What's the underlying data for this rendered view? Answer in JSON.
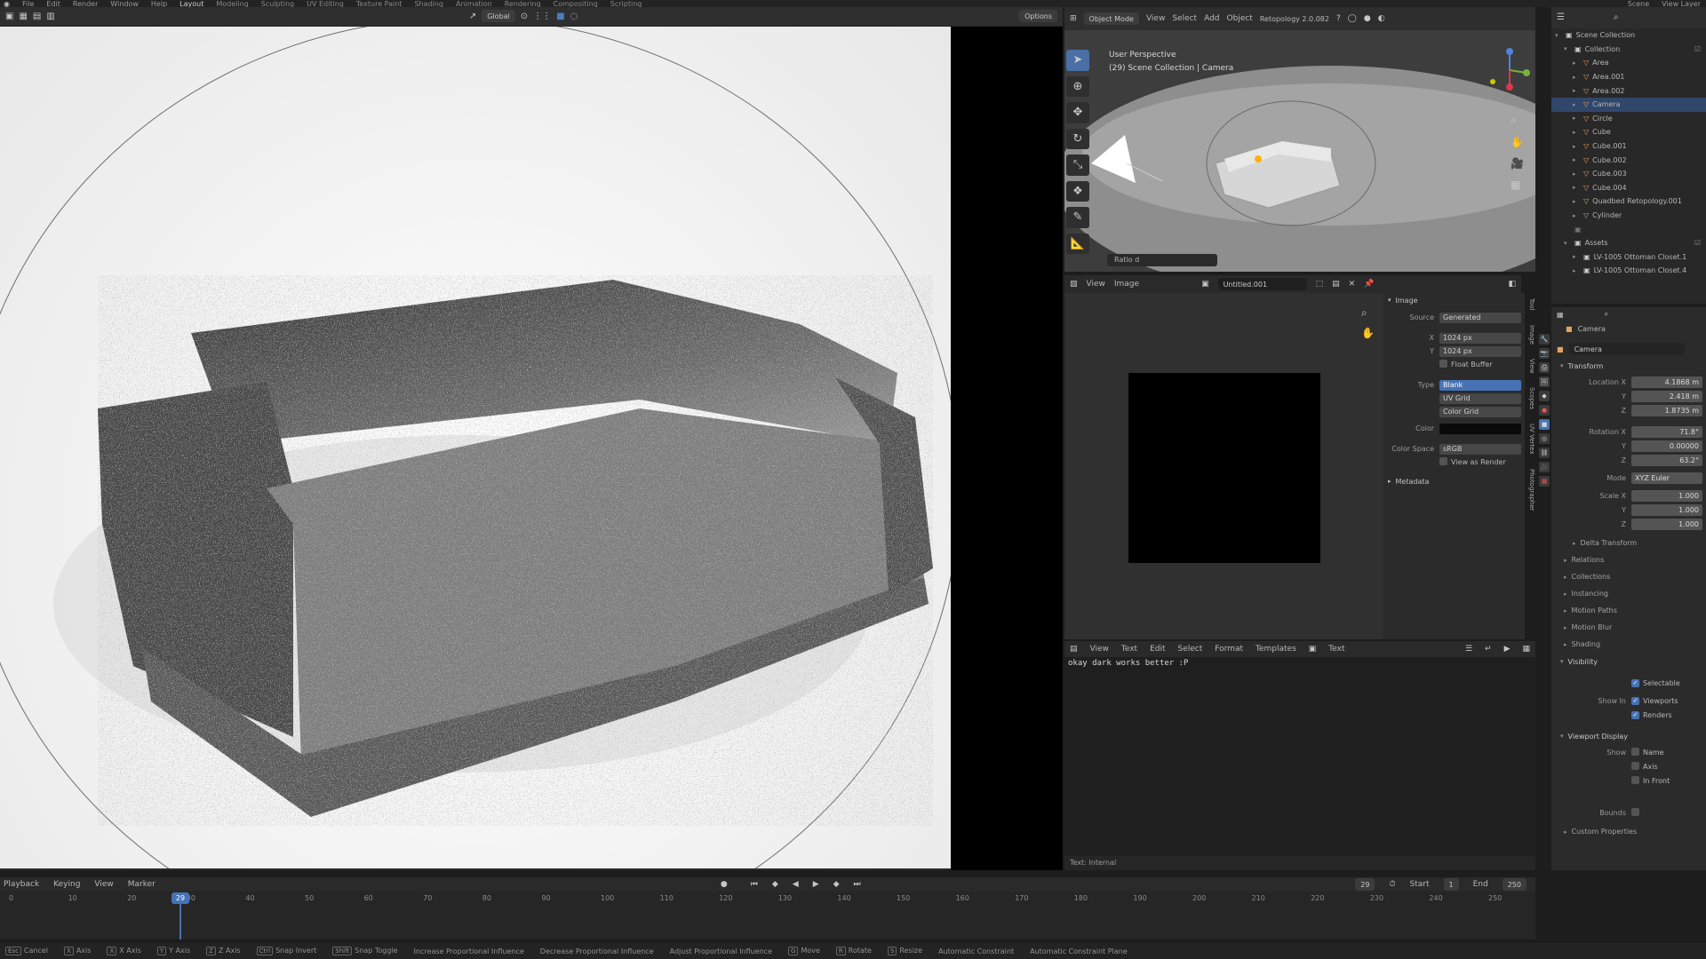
{
  "app": {
    "workspace_tabs": [
      "Layout",
      "Modeling",
      "Sculpting",
      "UV Editing",
      "Texture Paint",
      "Shading",
      "Animation",
      "Rendering",
      "Compositing",
      "Scripting"
    ],
    "active_workspace": "Layout",
    "menus": [
      "File",
      "Edit",
      "Render",
      "Window",
      "Help"
    ],
    "scene_label": "Scene",
    "view_layer_label": "View Layer"
  },
  "render_view": {
    "transform_orientation": "Global",
    "options_label": "Options"
  },
  "viewport3d": {
    "mode": "Object Mode",
    "menus": [
      "View",
      "Select",
      "Add",
      "Object"
    ],
    "orientation": "Global",
    "view_name": "User Perspective",
    "view_context": "(29) Scene Collection | Camera",
    "retopology_label": "Retopology 2.0.082",
    "overlay_label": "Ratio d"
  },
  "image_editor": {
    "menus": [
      "View",
      "Image"
    ],
    "image_name": "Untitled.001",
    "panel_title": "Image",
    "source_label": "Source",
    "source_value": "Generated",
    "x_label": "X",
    "x_value": "1024 px",
    "y_label": "Y",
    "y_value": "1024 px",
    "float_buffer_label": "Float Buffer",
    "type_label": "Type",
    "type_options": [
      "Blank",
      "UV Grid",
      "Color Grid"
    ],
    "type_selected": "Blank",
    "color_label": "Color",
    "color_value": "#0a0a0a",
    "color_space_label": "Color Space",
    "color_space_value": "sRGB",
    "view_as_render_label": "View as Render",
    "metadata_label": "Metadata",
    "side_tabs": [
      "Tool",
      "Image",
      "View",
      "Scopes",
      "UV Vertex",
      "Photographer"
    ]
  },
  "text_editor": {
    "menus": [
      "View",
      "Text",
      "Edit",
      "Select",
      "Format",
      "Templates"
    ],
    "text_name": "Text",
    "content": "okay dark works better :P",
    "footer": "Text: Internal"
  },
  "outliner": {
    "items": [
      {
        "label": "Scene Collection",
        "depth": 0,
        "type": "collection"
      },
      {
        "label": "Collection",
        "depth": 1,
        "type": "collection"
      },
      {
        "label": "Area",
        "depth": 2,
        "type": "object"
      },
      {
        "label": "Area.001",
        "depth": 2,
        "type": "object"
      },
      {
        "label": "Area.002",
        "depth": 2,
        "type": "object"
      },
      {
        "label": "Camera",
        "depth": 2,
        "type": "object",
        "selected": true
      },
      {
        "label": "Circle",
        "depth": 2,
        "type": "object"
      },
      {
        "label": "Cube",
        "depth": 2,
        "type": "object"
      },
      {
        "label": "Cube.001",
        "depth": 2,
        "type": "object"
      },
      {
        "label": "Cube.002",
        "depth": 2,
        "type": "object"
      },
      {
        "label": "Cube.003",
        "depth": 2,
        "type": "object"
      },
      {
        "label": "Cube.004",
        "depth": 2,
        "type": "object"
      },
      {
        "label": "Quadbed Retopology.001",
        "depth": 2,
        "type": "object"
      },
      {
        "label": "Cylinder",
        "depth": 2,
        "type": "object"
      },
      {
        "label": "",
        "depth": 1,
        "type": "collection"
      },
      {
        "label": "Assets",
        "depth": 1,
        "type": "collection"
      },
      {
        "label": "LV-1005 Ottoman Closet.1",
        "depth": 2,
        "type": "object"
      },
      {
        "label": "LV-1005 Ottoman Closet.4",
        "depth": 2,
        "type": "object"
      }
    ]
  },
  "properties": {
    "object_name": "Camera",
    "data_name": "Camera",
    "transform_label": "Transform",
    "location_label": "Location X",
    "location": [
      "4.1868 m",
      "2.418 m",
      "1.8735 m"
    ],
    "rotation_label": "Rotation X",
    "rotation": [
      "71.8°",
      "0.00000",
      "63.2°"
    ],
    "mode_label": "Mode",
    "mode_value": "XYZ Euler",
    "scale_label": "Scale X",
    "scale": [
      "1.000",
      "1.000",
      "1.000"
    ],
    "axis_y": "Y",
    "axis_z": "Z",
    "subsections": [
      "Delta Transform",
      "Relations",
      "Collections",
      "Instancing",
      "Motion Paths",
      "Motion Blur",
      "Shading",
      "Visibility"
    ],
    "selectable_label": "Selectable",
    "show_in_label": "Show In",
    "viewports_label": "Viewports",
    "renders_label": "Renders",
    "viewport_display_label": "Viewport Display",
    "show_label": "Show",
    "name_label": "Name",
    "axis_label": "Axis",
    "in_front_label": "In Front",
    "bounds_label": "Bounds",
    "custom_properties_label": "Custom Properties"
  },
  "timeline": {
    "menus": [
      "Playback",
      "Keying",
      "View",
      "Marker"
    ],
    "current_frame": "29",
    "ticks": [
      "0",
      "10",
      "20",
      "30",
      "40",
      "50",
      "60",
      "70",
      "80",
      "90",
      "100",
      "110",
      "120",
      "130",
      "140",
      "150",
      "160",
      "170",
      "180",
      "190",
      "200",
      "210",
      "220",
      "230",
      "240",
      "250"
    ],
    "start_label": "Start",
    "start_value": "1",
    "end_label": "End",
    "end_value": "250"
  },
  "statusbar": {
    "items": [
      "Cancel",
      "Axis",
      "X Axis",
      "Y Axis",
      "Z Axis",
      "Snap Invert",
      "Snap Toggle",
      "Increase Proportional Influence",
      "Decrease Proportional Influence",
      "Adjust Proportional Influence",
      "Move",
      "Rotate",
      "Resize",
      "Automatic Constraint",
      "Automatic Constraint Plane"
    ]
  },
  "colors": {
    "accent": "#4672b5",
    "background": "#1d1d1d",
    "panel": "#2b2b2b"
  }
}
